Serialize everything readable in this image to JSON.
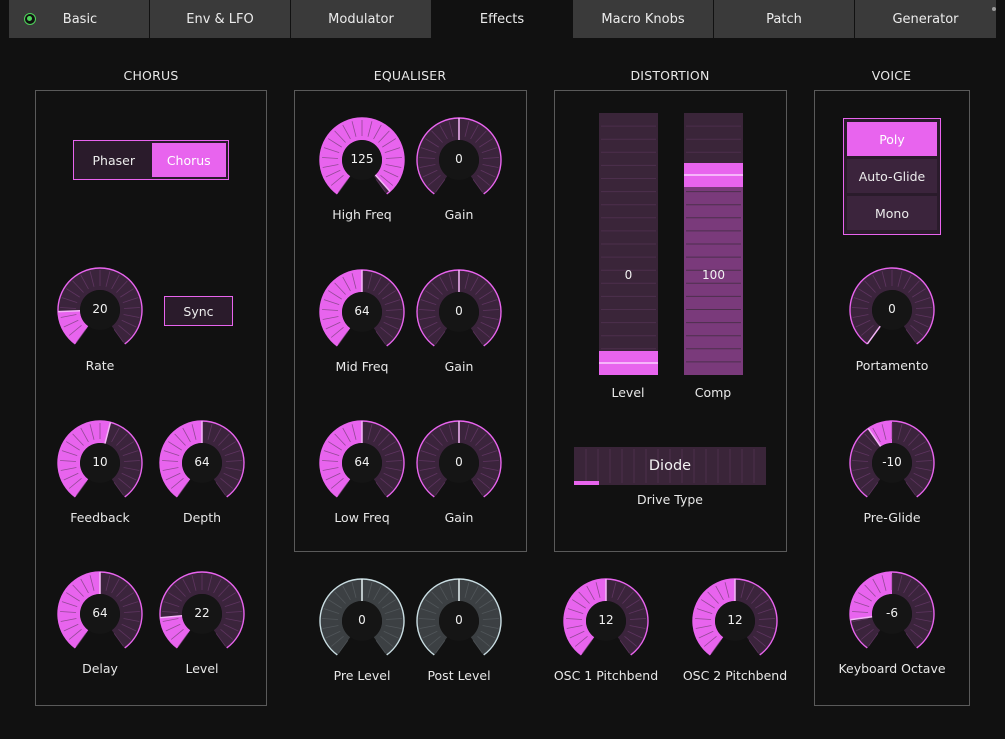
{
  "tabs": [
    {
      "label": "Basic",
      "active": false
    },
    {
      "label": "Env & LFO",
      "active": false
    },
    {
      "label": "Modulator",
      "active": false
    },
    {
      "label": "Effects",
      "active": true
    },
    {
      "label": "Macro Knobs",
      "active": false
    },
    {
      "label": "Patch",
      "active": false
    },
    {
      "label": "Generator",
      "active": false
    }
  ],
  "colors": {
    "accent": "#e864ee",
    "accent_dark": "#3b243c",
    "silver": "#c9dde2",
    "panel_border": "#5a5a5a",
    "led": "#4ed55a"
  },
  "chorus": {
    "title": "CHORUS",
    "mode": {
      "options": [
        "Phaser",
        "Chorus"
      ],
      "selected": 1
    },
    "sync_label": "Sync",
    "rate": {
      "label": "Rate",
      "value": "20",
      "fraction": 0.18
    },
    "feedback": {
      "label": "Feedback",
      "value": "10",
      "fraction": 0.55
    },
    "depth": {
      "label": "Depth",
      "value": "64",
      "fraction": 0.5
    },
    "delay": {
      "label": "Delay",
      "value": "64",
      "fraction": 0.5
    },
    "level": {
      "label": "Level",
      "value": "22",
      "fraction": 0.17
    }
  },
  "equaliser": {
    "title": "EQUALISER",
    "high_freq": {
      "label": "High Freq",
      "value": "125",
      "fraction": 0.98
    },
    "high_gain": {
      "label": "Gain",
      "value": "0",
      "fraction": 0.5,
      "bipolar": true
    },
    "mid_freq": {
      "label": "Mid Freq",
      "value": "64",
      "fraction": 0.5
    },
    "mid_gain": {
      "label": "Gain",
      "value": "0",
      "fraction": 0.5,
      "bipolar": true
    },
    "low_freq": {
      "label": "Low Freq",
      "value": "64",
      "fraction": 0.5
    },
    "low_gain": {
      "label": "Gain",
      "value": "0",
      "fraction": 0.5,
      "bipolar": true
    },
    "pre_level": {
      "label": "Pre Level",
      "value": "0",
      "fraction": 0.5,
      "bipolar": true
    },
    "post_level": {
      "label": "Post Level",
      "value": "0",
      "fraction": 0.5,
      "bipolar": true
    }
  },
  "distortion": {
    "title": "DISTORTION",
    "level": {
      "label": "Level",
      "value": "0",
      "fraction": 0.0
    },
    "comp": {
      "label": "Comp",
      "value": "100",
      "fraction": 0.79
    },
    "drive_type": {
      "label": "Drive Type",
      "value": "Diode",
      "fraction": 0.13
    }
  },
  "pitchbend": {
    "osc1": {
      "label": "OSC 1 Pitchbend",
      "value": "12",
      "fraction": 0.5
    },
    "osc2": {
      "label": "OSC 2 Pitchbend",
      "value": "12",
      "fraction": 0.5
    }
  },
  "voice": {
    "title": "VOICE",
    "modes": [
      "Poly",
      "Auto-Glide",
      "Mono"
    ],
    "selected_mode": 0,
    "portamento": {
      "label": "Portamento",
      "value": "0",
      "fraction": 0.0
    },
    "pre_glide": {
      "label": "Pre-Glide",
      "value": "-10",
      "fraction": 0.38,
      "bipolar": true
    },
    "keyboard_octave": {
      "label": "Keyboard Octave",
      "value": "-6",
      "fraction": 0.16,
      "bipolar": true
    }
  }
}
